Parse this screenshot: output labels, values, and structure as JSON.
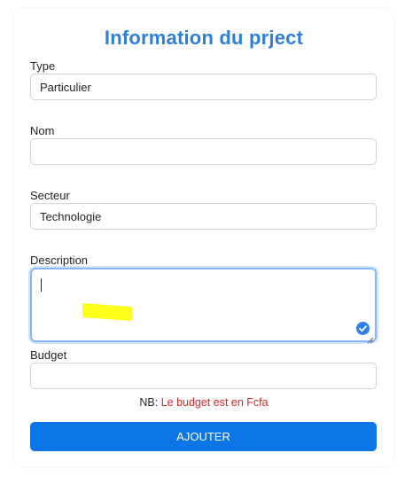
{
  "form": {
    "title": "Information du prject",
    "fields": {
      "type": {
        "label": "Type",
        "value": "Particulier"
      },
      "nom": {
        "label": "Nom",
        "value": ""
      },
      "secteur": {
        "label": "Secteur",
        "value": "Technologie"
      },
      "description": {
        "label": "Description",
        "value": ""
      },
      "budget": {
        "label": "Budget",
        "value": ""
      }
    },
    "note": {
      "prefix": "NB: ",
      "text": "Le budget est en Fcfa"
    },
    "submit_label": "AJOUTER"
  },
  "icons": {
    "textarea_status": "check-circle-icon",
    "textarea_resize": "resize-handle-icon"
  },
  "colors": {
    "title": "#2f7fd8",
    "button": "#0d76e6",
    "note_accent": "#e02424",
    "focus_border": "#86b7fe",
    "highlight": "#ffff1a"
  }
}
